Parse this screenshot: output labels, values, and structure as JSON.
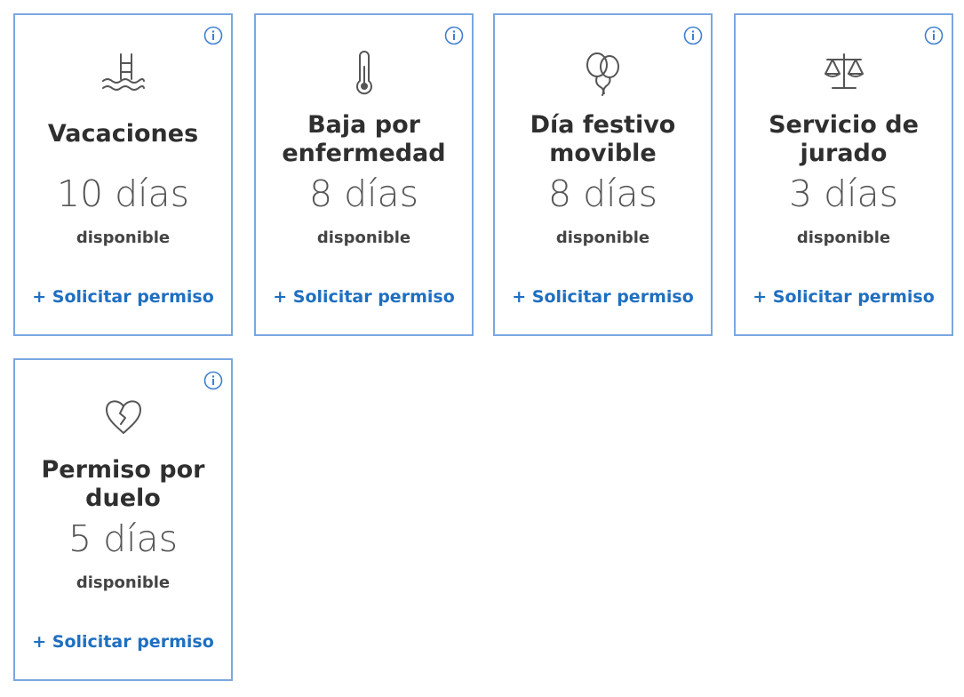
{
  "colors": {
    "accent": "#1f6fc0",
    "card_border": "#7aa7e0"
  },
  "cards": [
    {
      "icon": "pool-ladder-icon",
      "title": "Vacaciones",
      "days": "10 días",
      "available": "disponible",
      "request": "+ Solicitar permiso"
    },
    {
      "icon": "thermometer-icon",
      "title": "Baja por enfermedad",
      "days": "8 días",
      "available": "disponible",
      "request": "+ Solicitar permiso"
    },
    {
      "icon": "balloons-icon",
      "title": "Día festivo movible",
      "days": "8 días",
      "available": "disponible",
      "request": "+ Solicitar permiso"
    },
    {
      "icon": "scales-icon",
      "title": "Servicio de jurado",
      "days": "3 días",
      "available": "disponible",
      "request": "+ Solicitar permiso"
    },
    {
      "icon": "broken-heart-icon",
      "title": "Permiso por duelo",
      "days": "5 días",
      "available": "disponible",
      "request": "+ Solicitar permiso"
    }
  ]
}
